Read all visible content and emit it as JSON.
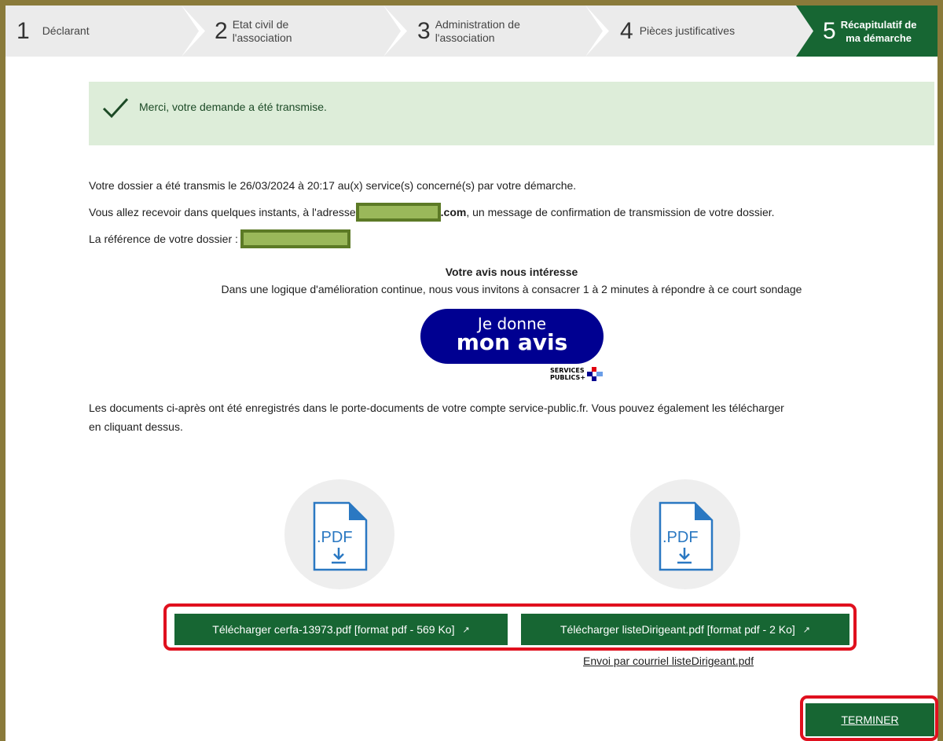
{
  "stepper": {
    "steps": [
      {
        "num": "1",
        "label": "Déclarant"
      },
      {
        "num": "2",
        "label_line1": "Etat civil de",
        "label_line2": "l'association"
      },
      {
        "num": "3",
        "label_line1": "Administration de",
        "label_line2": "l'association"
      },
      {
        "num": "4",
        "label": "Pièces justificatives"
      },
      {
        "num": "5",
        "label_line1": "Récapitulatif de",
        "label_line2": "ma démarche",
        "active": true
      }
    ]
  },
  "banner": {
    "message": "Merci, votre demande a été transmise."
  },
  "body": {
    "line1": "Votre dossier a été transmis le 26/03/2024 à 20:17 au(x) service(s) concerné(s) par votre démarche.",
    "line2_prefix": "Vous allez recevoir dans quelques instants, à l'adresse",
    "line2_domain": ".com",
    "line2_suffix": ", un message de confirmation de transmission de votre dossier.",
    "line3": "La référence de votre dossier :",
    "survey_title": "Votre avis nous intéresse",
    "survey_text": "Dans une logique d'amélioration continue, nous vous invitons à consacrer 1 à 2 minutes à répondre à ce court sondage",
    "docs_line1": "Les documents ci-après ont été enregistrés dans le porte-documents de votre compte service-public.fr. Vous pouvez également les télécharger",
    "docs_line2": "en cliquant dessus."
  },
  "avis_button": {
    "line1": "Je donne",
    "line2": "mon avis",
    "logo_line1": "SERVICES",
    "logo_line2": "PUBLICS+"
  },
  "pdf_icon_label": ".PDF",
  "downloads": [
    {
      "label": "Télécharger cerfa-13973.pdf [format pdf - 569 Ko]"
    },
    {
      "label": "Télécharger listeDirigeant.pdf [format pdf - 2 Ko]"
    }
  ],
  "external_icon": "external-link-icon",
  "mail_link": "Envoi par courriel listeDirigeant.pdf",
  "finish_button": "TERMINER",
  "colors": {
    "primary_green": "#176633",
    "success_bg": "#ddedd9",
    "highlight_red": "#e0101e",
    "avis_blue": "#000091"
  }
}
